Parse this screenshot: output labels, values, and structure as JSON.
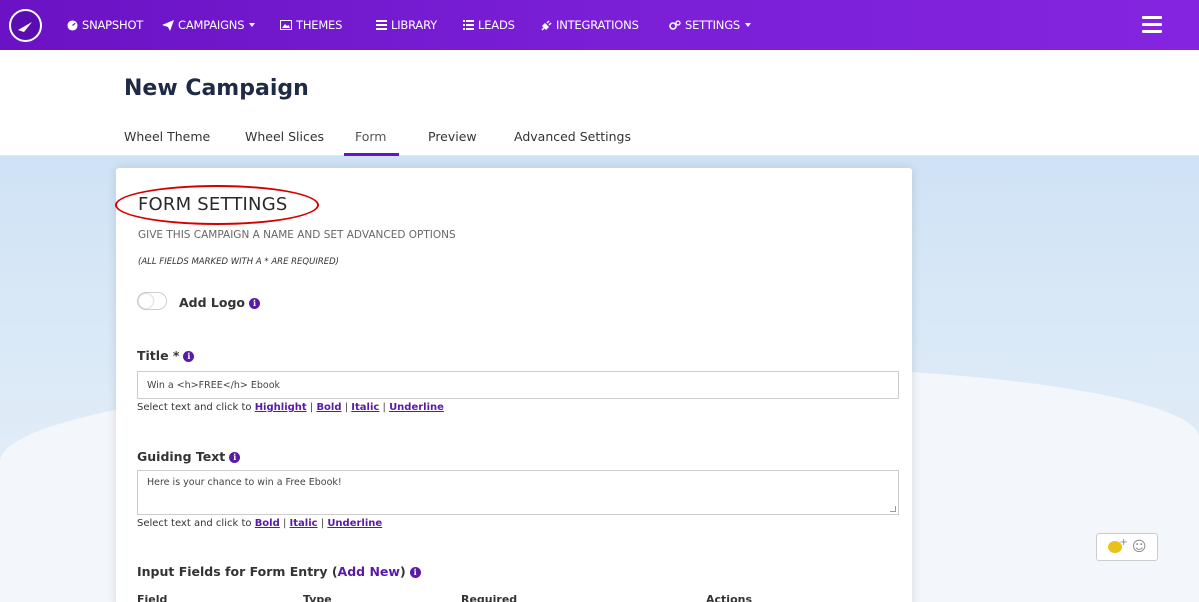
{
  "nav": {
    "items": [
      {
        "label": "SNAPSHOT",
        "icon": "dashboard-icon"
      },
      {
        "label": "CAMPAIGNS",
        "icon": "paper-plane-icon",
        "dropdown": true
      },
      {
        "label": "THEMES",
        "icon": "image-icon"
      },
      {
        "label": "LIBRARY",
        "icon": "list-icon"
      },
      {
        "label": "LEADS",
        "icon": "list-ul-icon"
      },
      {
        "label": "INTEGRATIONS",
        "icon": "plug-icon"
      },
      {
        "label": "SETTINGS",
        "icon": "cogs-icon",
        "dropdown": true
      }
    ],
    "brand_color": "#6a12c4"
  },
  "page": {
    "title": "New Campaign",
    "tabs": [
      {
        "label": "Wheel Theme",
        "active": false
      },
      {
        "label": "Wheel Slices",
        "active": false
      },
      {
        "label": "Form",
        "active": true
      },
      {
        "label": "Preview",
        "active": false
      },
      {
        "label": "Advanced Settings",
        "active": false
      }
    ]
  },
  "form": {
    "title": "FORM SETTINGS",
    "subtitle": "GIVE THIS CAMPAIGN A NAME AND SET ADVANCED OPTIONS",
    "note": "(ALL FIELDS MARKED WITH A * ARE REQUIRED)",
    "add_logo_label": "Add Logo",
    "add_logo_enabled": false,
    "title_label": "Title *",
    "title_value": "Win a <h>FREE</h> Ebook",
    "title_helper_prefix": "Select text and click to",
    "title_helper_links": [
      "Highlight",
      "Bold",
      "Italic",
      "Underline"
    ],
    "guiding_label": "Guiding Text",
    "guiding_value": "Here is your chance to win a Free Ebook!",
    "guiding_helper_prefix": "Select text and click to",
    "guiding_helper_links": [
      "Bold",
      "Italic",
      "Underline"
    ],
    "input_fields_label": "Input Fields for Form Entry (",
    "add_new_label": "Add New",
    "input_fields_close": ")",
    "columns": [
      "Field",
      "Type",
      "Required",
      "Actions"
    ],
    "sep": "|"
  }
}
